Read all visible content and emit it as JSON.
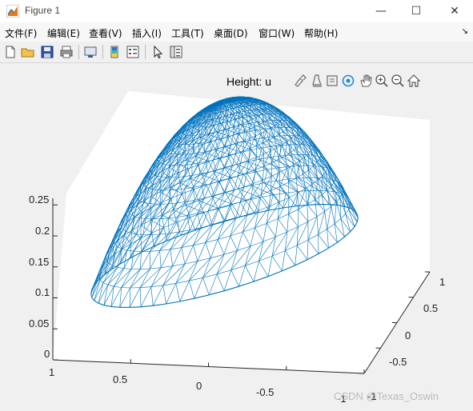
{
  "window": {
    "title": "Figure 1",
    "minimize_glyph": "—",
    "maximize_glyph": "☐",
    "close_glyph": "✕"
  },
  "menu": {
    "items": [
      {
        "label": "文件(F)"
      },
      {
        "label": "编辑(E)"
      },
      {
        "label": "查看(V)"
      },
      {
        "label": "插入(I)"
      },
      {
        "label": "工具(T)"
      },
      {
        "label": "桌面(D)"
      },
      {
        "label": "窗口(W)"
      },
      {
        "label": "帮助(H)"
      }
    ],
    "pin_glyph": "↘"
  },
  "toolbar": {
    "icons": [
      "new-file-icon",
      "open-folder-icon",
      "save-icon",
      "print-icon",
      "link-plot-icon",
      "colorbar-icon",
      "legend-icon",
      "pointer-icon",
      "property-inspector-icon"
    ]
  },
  "axes": {
    "title": "Height: u",
    "tools": [
      "brush-icon",
      "data-tips-icon",
      "export-icon",
      "rotate-3d-icon",
      "pan-icon",
      "zoom-in-icon",
      "zoom-out-icon",
      "home-icon"
    ],
    "z_ticks": [
      "0.25",
      "0.2",
      "0.15",
      "0.1",
      "0.05",
      "0"
    ],
    "x_ticks": [
      "1",
      "0.5",
      "0",
      "-0.5",
      "-1"
    ],
    "y_ticks": [
      "-1",
      "-0.5",
      "0",
      "0.5",
      "1"
    ]
  },
  "chart_data": {
    "type": "surface",
    "title": "Height: u",
    "x_range": [
      -1,
      1
    ],
    "y_range": [
      -1,
      1
    ],
    "z_range": [
      0,
      0.25
    ],
    "peak": {
      "x": 0,
      "y": 0,
      "z": 0.25
    },
    "surface": "z = 0.25*(1 - x^2 - y^2) on the unit disk",
    "style": "triangulated mesh",
    "mesh_color": "#0072bd"
  },
  "watermark": "CSDN @Texas_Oswin"
}
